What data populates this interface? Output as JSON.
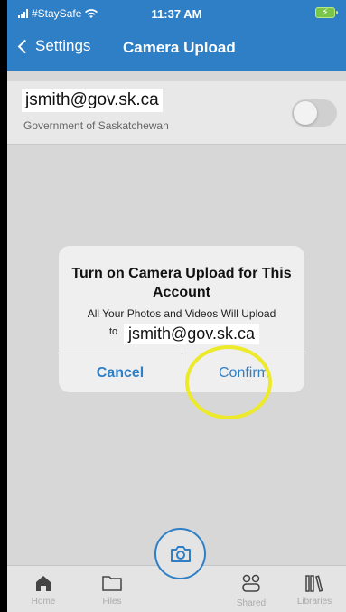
{
  "status_bar": {
    "carrier": "#StaySafe",
    "time": "11:37 AM",
    "icons": [
      "signal-icon",
      "wifi-icon",
      "battery-charging-icon"
    ]
  },
  "nav": {
    "back_label": "Settings",
    "title": "Camera Upload"
  },
  "account": {
    "email": "jsmith@gov.sk.ca",
    "org": "Government of Saskatchewan",
    "toggle_on": false
  },
  "dialog": {
    "title": "Turn on Camera Upload for This Account",
    "message": "All Your Photos and Videos Will Upload",
    "to": "to",
    "email": "jsmith@gov.sk.ca",
    "cancel_label": "Cancel",
    "confirm_label": "Confirm"
  },
  "tabs": [
    {
      "label": "Home",
      "icon": "home-icon"
    },
    {
      "label": "Files",
      "icon": "folder-icon"
    },
    {
      "label": "",
      "icon": "camera-icon"
    },
    {
      "label": "Shared",
      "icon": "shared-icon"
    },
    {
      "label": "Libraries",
      "icon": "libraries-icon"
    }
  ],
  "colors": {
    "brand_blue": "#2f7fc7",
    "highlight_yellow": "#ecea2a",
    "background_gray": "#d7d7d7"
  }
}
